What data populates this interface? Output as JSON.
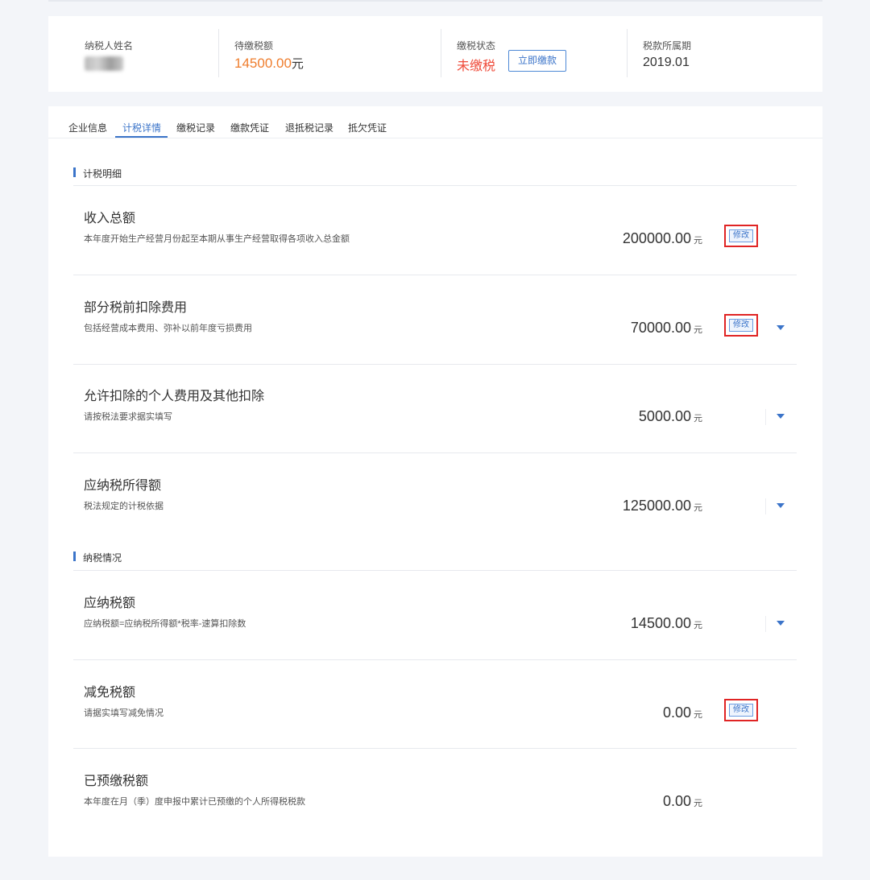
{
  "summary": {
    "taxpayer_label": "纳税人姓名",
    "due_label": "待缴税额",
    "due_amount": "14500.00",
    "due_unit": "元",
    "status_label": "缴税状态",
    "status_value": "未缴税",
    "pay_button": "立即缴款",
    "period_label": "税款所属期",
    "period_value": "2019.01"
  },
  "tabs": [
    {
      "label": "企业信息"
    },
    {
      "label": "计税详情",
      "active": true
    },
    {
      "label": "缴税记录"
    },
    {
      "label": "缴款凭证"
    },
    {
      "label": "退抵税记录"
    },
    {
      "label": "抵欠凭证"
    }
  ],
  "sections": {
    "calc_title": "计税明细",
    "pay_title": "纳税情况"
  },
  "unit": "元",
  "edit_label": "修改",
  "rows": [
    {
      "title": "收入总额",
      "desc": "本年度开始生产经营月份起至本期从事生产经营取得各项收入总金额",
      "value": "200000.00"
    },
    {
      "title": "部分税前扣除费用",
      "desc": "包括经营成本费用、弥补以前年度亏损费用",
      "value": "70000.00"
    },
    {
      "title": "允许扣除的个人费用及其他扣除",
      "desc": "请按税法要求据实填写",
      "value": "5000.00"
    },
    {
      "title": "应纳税所得额",
      "desc": "税法规定的计税依据",
      "value": "125000.00"
    },
    {
      "title": "应纳税额",
      "desc": "应纳税额=应纳税所得额*税率-速算扣除数",
      "value": "14500.00"
    },
    {
      "title": "减免税额",
      "desc": "请据实填写减免情况",
      "value": "0.00"
    },
    {
      "title": "已预缴税额",
      "desc": "本年度在月（季）度申报中累计已预缴的个人所得税税款",
      "value": "0.00"
    }
  ],
  "colors": {
    "accent": "#3b74c9",
    "amount": "#ef7d2d",
    "unpaid": "#ef4b3a",
    "highlight_border": "#e02424"
  }
}
